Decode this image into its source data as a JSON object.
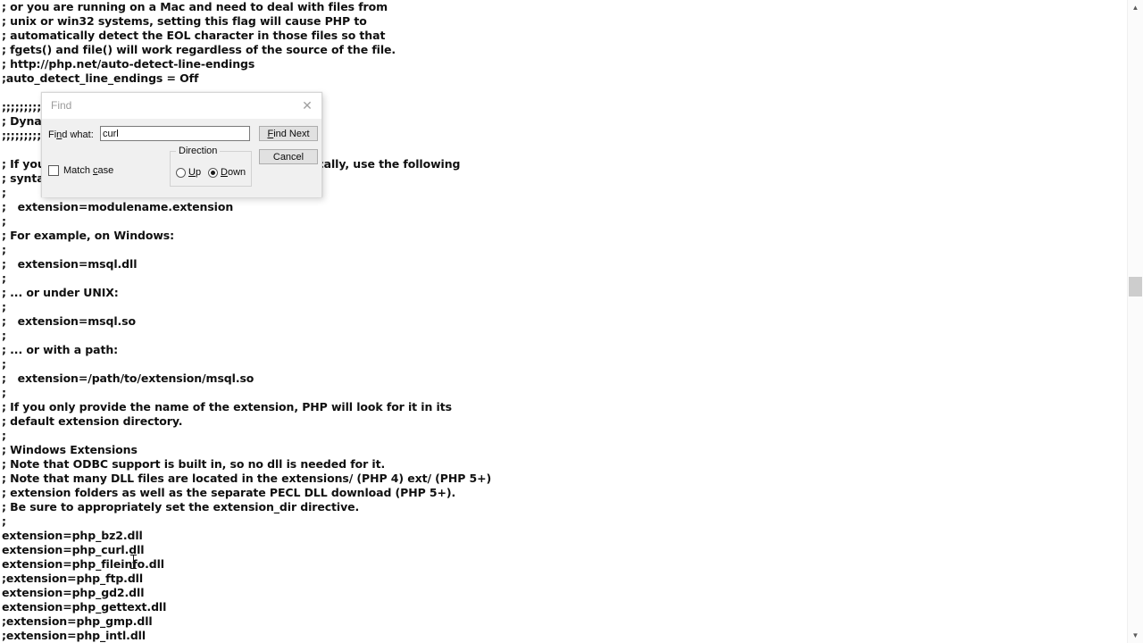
{
  "editor": {
    "lines": [
      "; or you are running on a Mac and need to deal with files from",
      "; unix or win32 systems, setting this flag will cause PHP to",
      "; automatically detect the EOL character in those files so that",
      "; fgets() and file() will work regardless of the source of the file.",
      "; http://php.net/auto-detect-line-endings",
      ";auto_detect_line_endings = Off",
      "",
      ";;;;;;;;;;;;;;;;;;;;;;;;;;;;;;;;;;;;;;;;;",
      "; Dynamic Extensions ;",
      ";;;;;;;;;;;;;;;;;;;;;;;;;;;;;;;;;;;;;;;;;",
      "",
      "; If you wish to have an extension loaded automatically, use the following",
      "; syntax:",
      ";",
      ";   extension=modulename.extension",
      ";",
      "; For example, on Windows:",
      ";",
      ";   extension=msql.dll",
      ";",
      "; ... or under UNIX:",
      ";",
      ";   extension=msql.so",
      ";",
      "; ... or with a path:",
      ";",
      ";   extension=/path/to/extension/msql.so",
      ";",
      "; If you only provide the name of the extension, PHP will look for it in its",
      "; default extension directory.",
      ";",
      "; Windows Extensions",
      "; Note that ODBC support is built in, so no dll is needed for it.",
      "; Note that many DLL files are located in the extensions/ (PHP 4) ext/ (PHP 5+)",
      "; extension folders as well as the separate PECL DLL download (PHP 5+).",
      "; Be sure to appropriately set the extension_dir directive.",
      ";",
      "extension=php_bz2.dll",
      "extension=php_curl.dll",
      "extension=php_fileinfo.dll",
      ";extension=php_ftp.dll",
      "extension=php_gd2.dll",
      "extension=php_gettext.dll",
      ";extension=php_gmp.dll",
      ";extension=php_intl.dll"
    ]
  },
  "scrollbar": {
    "up_arrow_glyph": "▲",
    "down_arrow_glyph": "▼"
  },
  "find_dialog": {
    "title": "Find",
    "close_glyph": "✕",
    "find_what_label_pre": "Fi",
    "find_what_label_accel": "n",
    "find_what_label_post": "d what:",
    "find_what_value": "curl",
    "find_what_placeholder": "",
    "find_next_accel": "F",
    "find_next_rest": "ind Next",
    "cancel_label": "Cancel",
    "direction_legend": "Direction",
    "up_accel": "U",
    "up_rest": "p",
    "up_selected": false,
    "down_accel": "D",
    "down_rest": "own",
    "down_selected": true,
    "match_case_pre": "Match ",
    "match_case_accel": "c",
    "match_case_post": "ase",
    "match_case_checked": false
  }
}
